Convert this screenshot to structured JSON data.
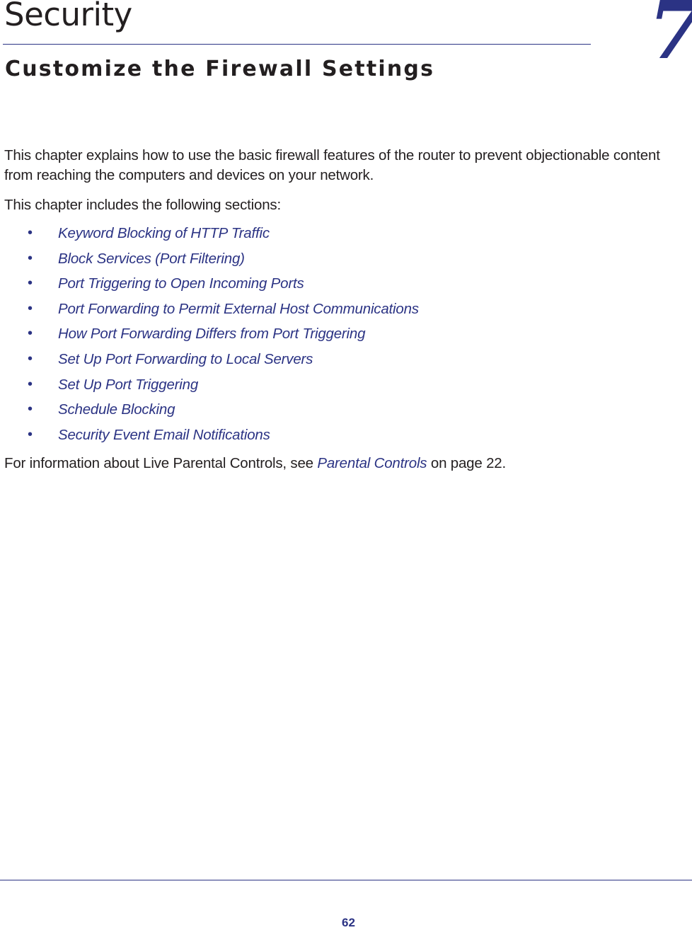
{
  "header": {
    "chapter_title": "Security",
    "chapter_subtitle": "Customize the Firewall Settings",
    "chapter_number": "7"
  },
  "body": {
    "intro": "This chapter explains how to use the basic firewall features of the router to prevent objectionable content from reaching the computers and devices on your network.",
    "sections_intro": "This chapter includes the following sections:",
    "bullet_glyph": "•",
    "sections": [
      {
        "label": "Keyword Blocking of HTTP Traffic"
      },
      {
        "label": "Block Services (Port Filtering)"
      },
      {
        "label": "Port Triggering to Open Incoming Ports"
      },
      {
        "label": "Port Forwarding to Permit External Host Communications"
      },
      {
        "label": "How Port Forwarding Differs from Port Triggering"
      },
      {
        "label": "Set Up Port Forwarding to Local Servers"
      },
      {
        "label": "Set Up Port Triggering"
      },
      {
        "label": "Schedule Blocking"
      },
      {
        "label": "Security Event Email Notifications"
      }
    ],
    "closing": {
      "prefix": "For information about Live Parental Controls, see ",
      "link_text": "Parental Controls",
      "suffix": " on page 22."
    }
  },
  "footer": {
    "page_number": "62"
  },
  "colors": {
    "accent": "#2b3384",
    "text": "#231f20"
  }
}
